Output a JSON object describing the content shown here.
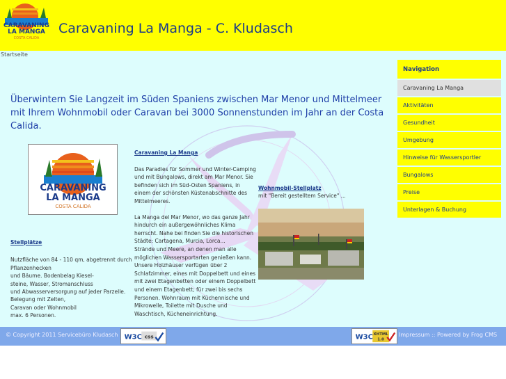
{
  "header": {
    "title": "Caravaning La Manga - C. Kludasch",
    "logo_text": [
      "CARAVANING",
      "LA MANGA",
      "COSTA CALIDA"
    ]
  },
  "breadcrumb": "Startseite",
  "headline": "Überwintern Sie Langzeit im Süden Spaniens zwischen Mar Menor und Mittelmeer mit Ihrem Wohnmobil oder Caravan bei 3000 Sonnenstunden im Jahr an der Costa Calida.",
  "caravaning_section": {
    "heading": "Caravaning La Manga",
    "para1": "Das Paradies für Sommer und Winter-Camping und mit Bungalows, direkt am Mar Menor. Sie befinden sich im Süd-Osten Spaniens, in einem der schönsten Küstenabschnitte des Mittelmeeres.",
    "para2": "La Manga del Mar Menor, wo das ganze Jahr hindurch ein außergewöhnliches Klima herrscht. Nahe bei finden Sie die historischen Städte: Cartagena, Murcia, Lorca...",
    "para3": "Strände und Meere, an denen man alle möglichen Wassersportarten genießen kann. Unsere Holzhäuser verfügen über 2 Schlafzimmer, eines mit Doppelbett und eines mit zwei Etagenbetten oder einem Doppelbett und einem Etagenbett; für zwei bis sechs Personen. Wohnraum mit Küchennische und Mikrowelle, Toilette mit Dusche und Waschtisch, Kücheneinrichtung."
  },
  "wohnmobil": {
    "heading": "Wohnmobil-Stellplatz",
    "text": "mit \"Bereit gestelltem Service\" ..."
  },
  "stellplaetze": {
    "heading": "Stellplätze",
    "lines": [
      "Nutzfläche von 84 - 110 qm, abgetrennt durch Pflanzenhecken",
      "und Bäume. Bodenbelag Kiesel-",
      "steine, Wasser, Stromanschluss",
      "und Abwasserversorgung auf jeder Parzelle.",
      "Belegung mit Zelten,",
      "Caravan oder Wohnmobil",
      "max. 6 Personen."
    ]
  },
  "nav": {
    "heading": "Navigation",
    "items": [
      "Caravaning La Manga",
      "Aktivitäten",
      "Gesundheit",
      "Umgebung",
      "Hinweise für Wassersportler",
      "Bungalows",
      "Preise",
      "Unterlagen & Buchung"
    ]
  },
  "footer": {
    "copyright": "© Copyright 2011 Servicebüro Kludasch",
    "impressum": "Impressum",
    "separator": "::",
    "powered": "Powered by Frog CMS",
    "w3c_css": "W3C css",
    "w3c_xhtml": "W3C XHTML 1.0"
  },
  "colors": {
    "header_bg": "#ffff00",
    "main_bg": "#ddfdfd",
    "footer_bg": "#7fa8ea",
    "link": "#1a3a8a"
  }
}
